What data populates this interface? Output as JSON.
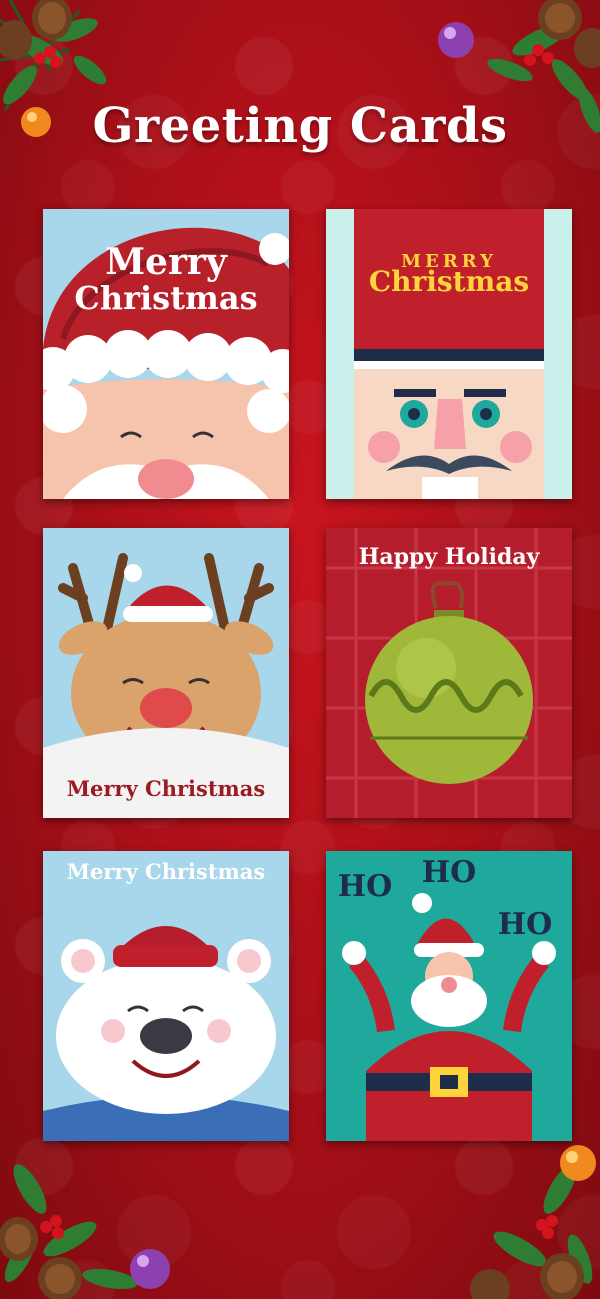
{
  "page": {
    "title": "Greeting Cards"
  },
  "cards": [
    {
      "name": "santa-hat-card",
      "line1": "Merry",
      "line2": "Christmas"
    },
    {
      "name": "nutcracker-card",
      "line1": "MERRY",
      "line2": "Christmas"
    },
    {
      "name": "reindeer-card",
      "text": "Merry Christmas"
    },
    {
      "name": "ornament-card",
      "text": "Happy Holiday"
    },
    {
      "name": "polar-bear-card",
      "text": "Merry Christmas"
    },
    {
      "name": "santa-hohoho-card",
      "ho1": "HO",
      "ho2": "HO",
      "ho3": "HO"
    }
  ],
  "colors": {
    "background": "#a50f17",
    "card_sky": "#a8d6ea",
    "santa_red": "#c0202c",
    "nutcracker_mint": "#c9f0ea",
    "plaid_red": "#b51d2c",
    "ornament_green": "#9fb83a",
    "teal": "#1fa99c"
  }
}
